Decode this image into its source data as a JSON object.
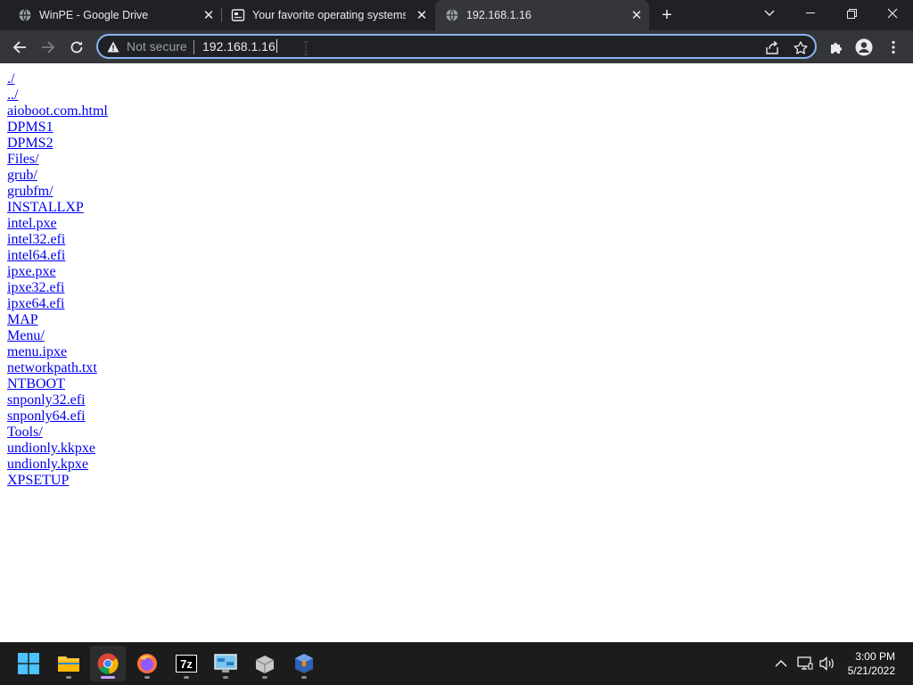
{
  "browser": {
    "tabs": [
      {
        "title": "WinPE - Google Drive",
        "icon": "globe-icon",
        "active": false
      },
      {
        "title": "Your favorite operating systems in one place",
        "icon": "document-icon",
        "active": false
      },
      {
        "title": "192.168.1.16",
        "icon": "globe-icon",
        "active": true
      }
    ],
    "address_bar": {
      "security_label": "Not secure",
      "url": "192.168.1.16"
    }
  },
  "directory_listing": {
    "entries": [
      "./",
      "../",
      "aioboot.com.html",
      "DPMS1",
      "DPMS2",
      "Files/",
      "grub/",
      "grubfm/",
      "INSTALLXP",
      "intel.pxe",
      "intel32.efi",
      "intel64.efi",
      "ipxe.pxe",
      "ipxe32.efi",
      "ipxe64.efi",
      "MAP",
      "Menu/",
      "menu.ipxe",
      "networkpath.txt",
      "NTBOOT",
      "snponly32.efi",
      "snponly64.efi",
      "Tools/",
      "undionly.kkpxe",
      "undionly.kpxe",
      "XPSETUP"
    ]
  },
  "taskbar": {
    "apps": [
      "start-icon",
      "file-explorer-icon",
      "chrome-icon",
      "firefox-icon",
      "7zip-icon",
      "control-panel-icon",
      "package-icon",
      "virtualbox-icon"
    ],
    "clock": {
      "time": "3:00 PM",
      "date": "5/21/2022"
    }
  },
  "colors": {
    "tabstrip": "#202124",
    "toolbar": "#35363a",
    "omnibox_focus": "#8ab4f8",
    "link": "#0000ee",
    "taskbar": "#1c1c1c"
  }
}
